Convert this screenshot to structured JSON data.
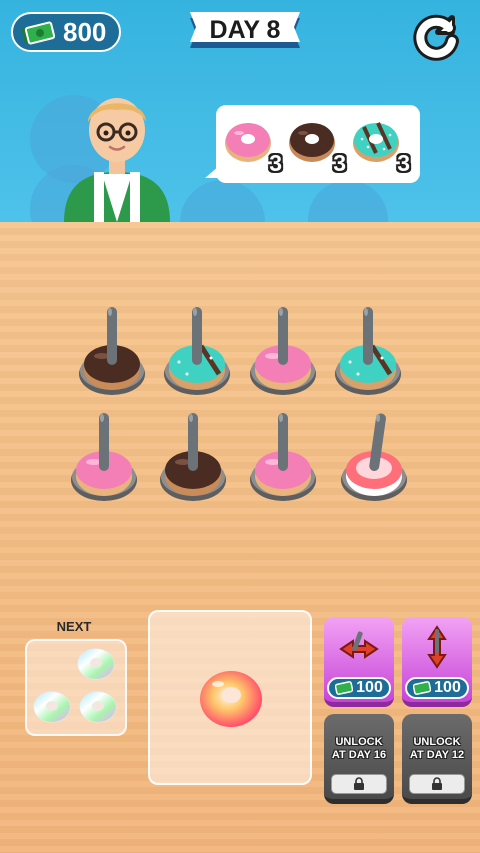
{
  "hud": {
    "money": "800",
    "day_label": "DAY 8",
    "restart_icon": "restart-icon"
  },
  "customer": {
    "order": [
      {
        "flavor": "pink",
        "count": "3"
      },
      {
        "flavor": "chocolate",
        "count": "3"
      },
      {
        "flavor": "mint",
        "count": "3"
      }
    ]
  },
  "board": {
    "pegs": [
      {
        "flavor": "chocolate"
      },
      {
        "flavor": "mint"
      },
      {
        "flavor": "pink"
      },
      {
        "flavor": "mint"
      },
      {
        "flavor": "pink"
      },
      {
        "flavor": "chocolate"
      },
      {
        "flavor": "pink"
      },
      {
        "flavor": "strawberry-white"
      }
    ]
  },
  "next": {
    "label": "NEXT",
    "items": [
      "rainbow",
      "rainbow",
      "rainbow"
    ]
  },
  "current_donut": "rainbow",
  "powerups": [
    {
      "price": "100",
      "icon": "swap-horizontal-icon"
    },
    {
      "price": "100",
      "icon": "swap-vertical-icon"
    },
    {
      "locked": true,
      "label_line1": "UNLOCK",
      "label_line2": "AT DAY 16"
    },
    {
      "locked": true,
      "label_line1": "UNLOCK",
      "label_line2": "AT DAY 12"
    }
  ],
  "colors": {
    "sky": "#3fb8e4",
    "table": "#f4bd84",
    "pink": "#f47fb7",
    "chocolate": "#4a2c22",
    "mint": "#3fd2c2",
    "powerup": "#d25ae0"
  }
}
